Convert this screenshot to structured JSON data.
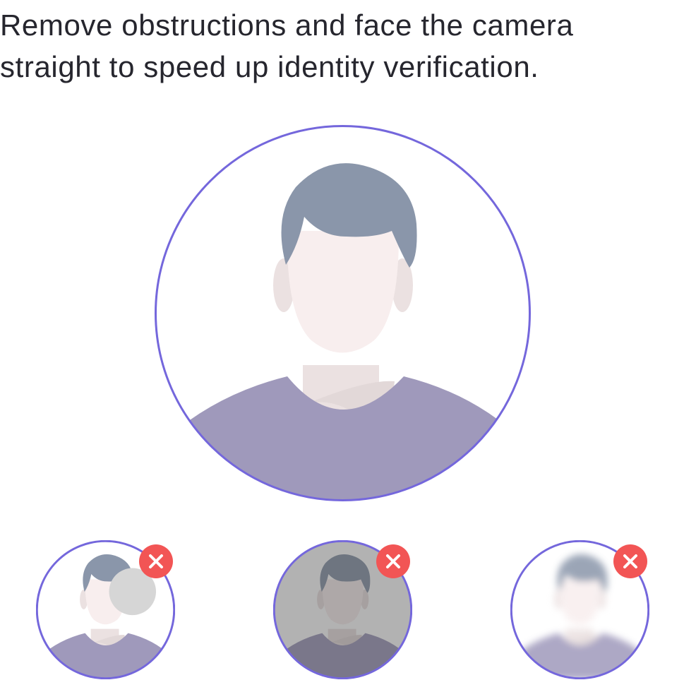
{
  "instruction": {
    "line1": "Remove obstructions and face the camera",
    "line2": "straight to speed up identity verification."
  },
  "hero_illustration": {
    "icon": "person-avatar-icon",
    "state": "correct"
  },
  "examples": [
    {
      "icon": "person-obstructed-icon",
      "issue": "obstruction",
      "status_icon": "error-x-icon"
    },
    {
      "icon": "person-dark-icon",
      "issue": "too-dark",
      "status_icon": "error-x-icon"
    },
    {
      "icon": "person-blurry-icon",
      "issue": "blurry",
      "status_icon": "error-x-icon"
    }
  ],
  "colors": {
    "text": "#26262e",
    "ring": "#7467dc",
    "hair": "#8a96aa",
    "skin": "#f8eeee",
    "skin_shadow": "#ebe1e1",
    "shirt": "#9f99bb",
    "error": "#f25555",
    "obstruction": "#d6d6d6",
    "dark_overlay": "#474747"
  }
}
